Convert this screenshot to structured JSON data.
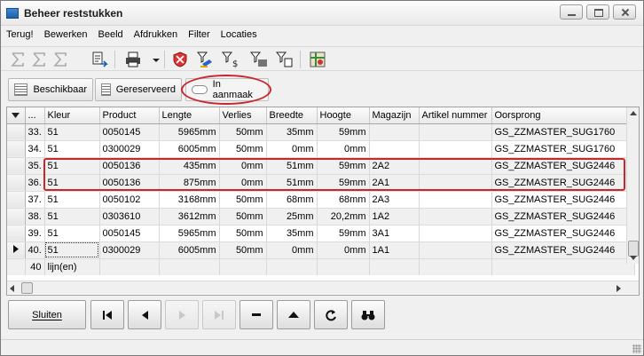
{
  "window": {
    "title": "Beheer reststukken"
  },
  "menu": [
    "Terug!",
    "Bewerken",
    "Beeld",
    "Afdrukken",
    "Filter",
    "Locaties"
  ],
  "toolbar": {
    "icons": [
      "sum-icon",
      "sum-icon",
      "sum-icon",
      "document-export-icon",
      "printer-icon",
      "dropdown-arrow-icon",
      "shield-cross-icon",
      "filter-paint-icon",
      "filter-dollar-icon",
      "filter-barcode-icon",
      "filter-document-icon",
      "map-icon"
    ]
  },
  "tabs": [
    {
      "label": "Beschikbaar"
    },
    {
      "label": "Gereserveerd"
    },
    {
      "label": "In aanmaak"
    }
  ],
  "grid": {
    "columns": [
      "...",
      "Kleur",
      "Product",
      "Lengte",
      "Verlies",
      "Breedte",
      "Hoogte",
      "Magazijn",
      "Artikel nummer",
      "Oorsprong"
    ],
    "rows": [
      {
        "n": "33.",
        "kleur": "51",
        "product": "0050145",
        "lengte": "5965mm",
        "verlies": "50mm",
        "breedte": "35mm",
        "hoogte": "59mm",
        "magazijn": "",
        "artikel": "",
        "oorsprong": "GS_ZZMASTER_SUG1760"
      },
      {
        "n": "34.",
        "kleur": "51",
        "product": "0300029",
        "lengte": "6005mm",
        "verlies": "50mm",
        "breedte": "0mm",
        "hoogte": "0mm",
        "magazijn": "",
        "artikel": "",
        "oorsprong": "GS_ZZMASTER_SUG1760"
      },
      {
        "n": "35.",
        "kleur": "51",
        "product": "0050136",
        "lengte": "435mm",
        "verlies": "0mm",
        "breedte": "51mm",
        "hoogte": "59mm",
        "magazijn": "2A2",
        "artikel": "",
        "oorsprong": "GS_ZZMASTER_SUG2446"
      },
      {
        "n": "36.",
        "kleur": "51",
        "product": "0050136",
        "lengte": "875mm",
        "verlies": "0mm",
        "breedte": "51mm",
        "hoogte": "59mm",
        "magazijn": "2A1",
        "artikel": "",
        "oorsprong": "GS_ZZMASTER_SUG2446"
      },
      {
        "n": "37.",
        "kleur": "51",
        "product": "0050102",
        "lengte": "3168mm",
        "verlies": "50mm",
        "breedte": "68mm",
        "hoogte": "68mm",
        "magazijn": "2A3",
        "artikel": "",
        "oorsprong": "GS_ZZMASTER_SUG2446"
      },
      {
        "n": "38.",
        "kleur": "51",
        "product": "0303610",
        "lengte": "3612mm",
        "verlies": "50mm",
        "breedte": "25mm",
        "hoogte": "20,2mm",
        "magazijn": "1A2",
        "artikel": "",
        "oorsprong": "GS_ZZMASTER_SUG2446"
      },
      {
        "n": "39.",
        "kleur": "51",
        "product": "0050145",
        "lengte": "5965mm",
        "verlies": "50mm",
        "breedte": "35mm",
        "hoogte": "59mm",
        "magazijn": "3A1",
        "artikel": "",
        "oorsprong": "GS_ZZMASTER_SUG2446"
      },
      {
        "n": "40.",
        "kleur": "51",
        "product": "0300029",
        "lengte": "6005mm",
        "verlies": "50mm",
        "breedte": "0mm",
        "hoogte": "0mm",
        "magazijn": "1A1",
        "artikel": "",
        "oorsprong": "GS_ZZMASTER_SUG2446"
      }
    ],
    "footer_count": "40",
    "footer_label": "lijn(en)"
  },
  "bottom": {
    "close_label": "Sluiten"
  },
  "colors": {
    "highlight": "#c8282d"
  }
}
